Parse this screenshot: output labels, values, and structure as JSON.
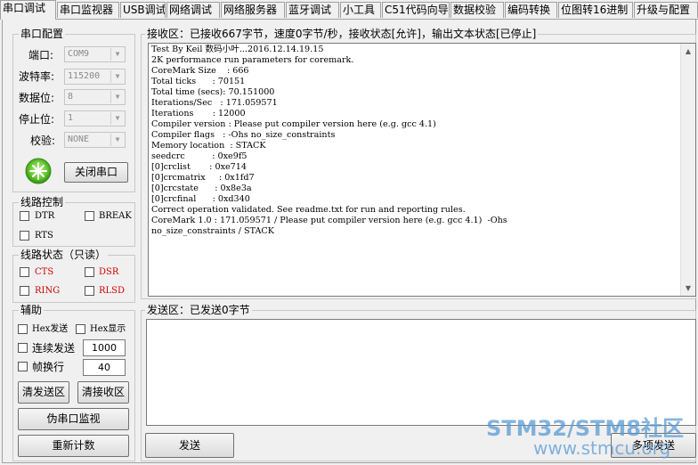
{
  "tabs": [
    "串口调试",
    "串口监视器",
    "USB调试",
    "网络调试",
    "网络服务器",
    "蓝牙调试",
    "小工具",
    "C51代码向导",
    "数据校验",
    "编码转换",
    "位图转16进制",
    "升级与配置"
  ],
  "serial_config": {
    "title": "串口配置",
    "port_label": "端口:",
    "port_value": "COM9",
    "baud_label": "波特率:",
    "baud_value": "115200",
    "databits_label": "数据位:",
    "databits_value": "8",
    "stopbits_label": "停止位:",
    "stopbits_value": "1",
    "parity_label": "校验:",
    "parity_value": "NONE",
    "close_button": "关闭串口"
  },
  "line_control": {
    "title": "线路控制",
    "dtr": "DTR",
    "break": "BREAK",
    "rts": "RTS"
  },
  "line_status": {
    "title": "线路状态（只读）",
    "cts": "CTS",
    "dsr": "DSR",
    "ring": "RING",
    "rlsd": "RLSD"
  },
  "aux": {
    "title": "辅助",
    "hex_send": "Hex发送",
    "hex_show": "Hex显示",
    "continuous_label": "连续发送",
    "continuous_value": "1000",
    "frame_label": "帧换行",
    "frame_value": "40",
    "clear_send": "清发送区",
    "clear_recv": "清接收区",
    "pseudo_monitor": "伪串口监视",
    "recount": "重新计数"
  },
  "receive": {
    "title": "接收区：已接收667字节，速度0字节/秒，接收状态[允许]，输出文本状态[已停止]",
    "lines": [
      "Test By Keil 数码小叶...2016.12.14.19.15",
      "2K performance run parameters for coremark.",
      "CoreMark Size    : 666",
      "Total ticks      : 70151",
      "Total time (secs): 70.151000",
      "Iterations/Sec   : 171.059571",
      "Iterations       : 12000",
      "Compiler version : Please put compiler version here (e.g. gcc 4.1)",
      "Compiler flags   : -Ohs no_size_constraints",
      "Memory location  : STACK",
      "seedcrc          : 0xe9f5",
      "[0]crclist       : 0xe714",
      "[0]crcmatrix     : 0x1fd7",
      "[0]crcstate      : 0x8e3a",
      "[0]crcfinal      : 0xd340",
      "Correct operation validated. See readme.txt for run and reporting rules.",
      "CoreMark 1.0 : 171.059571 / Please put compiler version here (e.g. gcc 4.1)  -Ohs",
      "no_size_constraints / STACK"
    ]
  },
  "send": {
    "title": "发送区：已发送0字节",
    "send_button": "发送",
    "multi_send_button": "多项发送"
  },
  "watermark": {
    "line1": "STM32/STM8社区",
    "line2": "www.stmcu.org"
  },
  "colors": {
    "status_label": "#d00000",
    "watermark": "#5a9bd5"
  }
}
